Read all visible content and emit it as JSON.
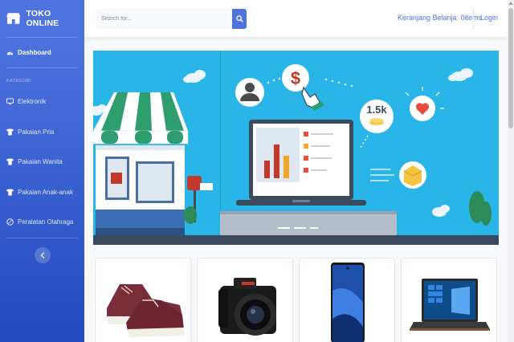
{
  "brand": {
    "name": "TOKO ONLINE"
  },
  "sidebar": {
    "dashboard_label": "Dashboard",
    "heading": "KATEGORI",
    "items": [
      {
        "label": "Elektronik",
        "icon": "desktop-icon"
      },
      {
        "label": "Pakaian Pria",
        "icon": "tshirt-icon"
      },
      {
        "label": "Pakaian Wanita",
        "icon": "tshirt-icon"
      },
      {
        "label": "Pakaian Anak-anak",
        "icon": "tshirt-icon"
      },
      {
        "label": "Peralatan Olahraga",
        "icon": "football-icon"
      }
    ],
    "toggle_icon": "chevron-left-icon"
  },
  "topbar": {
    "search_placeholder": "Search for...",
    "search_icon": "search-icon",
    "cart_label": "Keranjang Belanja: 0items",
    "login_label": "Login"
  },
  "banner": {
    "counter": "1.5k",
    "price_symbol": "$"
  },
  "products": [
    {
      "name": "sneaker",
      "color": "#7a2e3a"
    },
    {
      "name": "camera",
      "color": "#1a1a1a"
    },
    {
      "name": "smartphone",
      "color": "#1f4fa8"
    },
    {
      "name": "laptop",
      "color": "#2a2a2a"
    }
  ],
  "colors": {
    "primary": "#4e73df",
    "sidebar_end": "#224abe",
    "banner_bg": "#29b5e8"
  }
}
